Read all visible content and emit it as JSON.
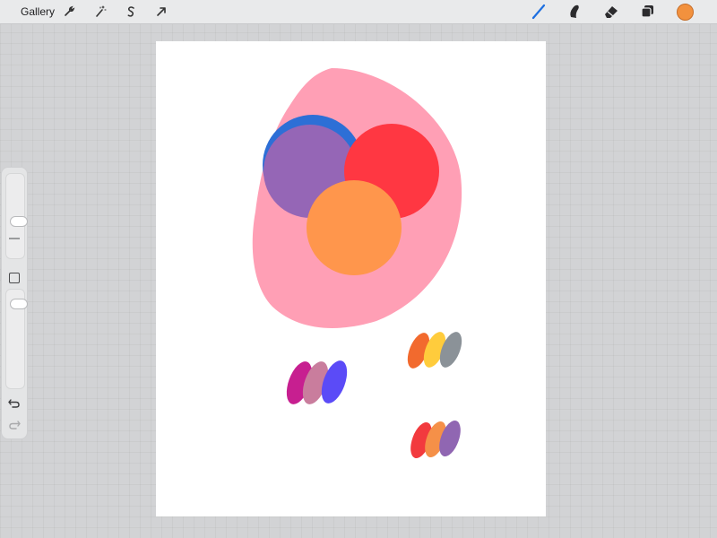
{
  "topbar": {
    "gallery_label": "Gallery",
    "left_tools": [
      "wrench-icon",
      "magic-wand-icon",
      "selection-s-icon",
      "transform-arrow-icon"
    ],
    "right_tools": [
      "brush-icon",
      "smudge-icon",
      "eraser-icon",
      "layers-icon"
    ],
    "current_color": "#F2913E"
  },
  "canvas": {
    "background": "#ffffff",
    "blob_color": "#FF9FB5",
    "circles": [
      {
        "name": "purple",
        "color": "#9566B6"
      },
      {
        "name": "red",
        "color": "#FF3742"
      },
      {
        "name": "orange",
        "color": "#FF964C"
      },
      {
        "name": "blue-edge",
        "color": "#2D6FD6"
      }
    ],
    "swatch_groups": [
      {
        "name": "purple-group",
        "colors": [
          "#C71F90",
          "#C97D9D",
          "#5B4BF7"
        ]
      },
      {
        "name": "warm-gray-group",
        "colors": [
          "#F26A2E",
          "#FFCC3C",
          "#8B9298"
        ]
      },
      {
        "name": "red-orange-purple-group",
        "colors": [
          "#F23A3E",
          "#F59048",
          "#9066B2"
        ]
      }
    ]
  },
  "sidebar": {
    "undo_icon": "undo-icon",
    "redo_icon": "redo-icon",
    "modify_icon": "modify-square-icon"
  }
}
